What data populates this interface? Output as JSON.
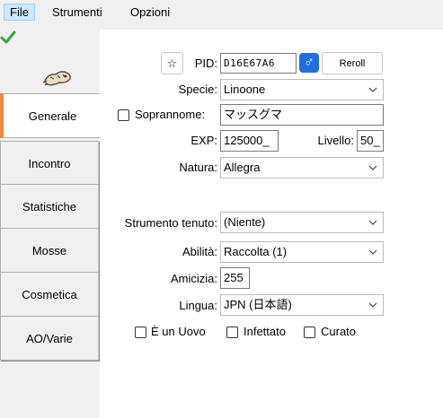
{
  "menu": {
    "file": "File",
    "tools": "Strumenti",
    "options": "Opzioni"
  },
  "tabs": [
    {
      "label": "Generale"
    },
    {
      "label": "Incontro"
    },
    {
      "label": "Statistiche"
    },
    {
      "label": "Mosse"
    },
    {
      "label": "Cosmetica"
    },
    {
      "label": "AO/Varie"
    }
  ],
  "icons": {
    "legal": "checkmark-icon",
    "sprite": "pokemon-sprite-icon",
    "favorite": "star-icon",
    "gender": "male-icon"
  },
  "colors": {
    "accent": "#f0883e",
    "gender_male": "#1e6fe0",
    "check": "#3aa63a"
  },
  "form": {
    "favorite_symbol": "☆",
    "pid_label": "PID:",
    "pid_value": "D16E67A6",
    "gender_symbol": "♂",
    "reroll_label": "Reroll",
    "species_label": "Specie:",
    "species_value": "Linoone",
    "nickname_label": "Soprannome:",
    "nickname_value": "マッスグマ",
    "exp_label": "EXP:",
    "exp_value": "125000_",
    "level_label": "Livello:",
    "level_value": "50_",
    "nature_label": "Natura:",
    "nature_value": "Allegra",
    "held_item_label": "Strumento tenuto:",
    "held_item_value": "(Niente)",
    "ability_label": "Abilità:",
    "ability_value": "Raccolta (1)",
    "friendship_label": "Amicizia:",
    "friendship_value": "255",
    "language_label": "Lingua:",
    "language_value": "JPN (日本語)",
    "is_egg_label": "È un Uovo",
    "infected_label": "Infettato",
    "cured_label": "Curato"
  }
}
